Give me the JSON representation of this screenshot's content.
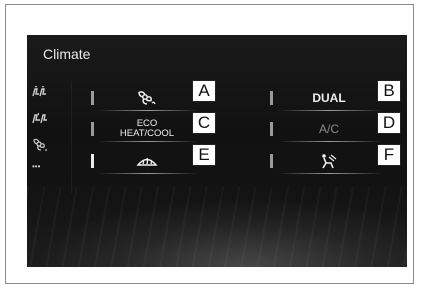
{
  "screen": {
    "title": "Climate"
  },
  "sidebar": {
    "items": [
      {
        "icon": "seat-ventilation-icon"
      },
      {
        "icon": "seat-heater-icon"
      },
      {
        "icon": "fan-icon"
      },
      {
        "icon": "more-icon",
        "label": "•••"
      }
    ]
  },
  "buttons": [
    {
      "id": "A",
      "icon": "fan-auto-icon",
      "label": "",
      "active": false
    },
    {
      "id": "B",
      "label": "DUAL",
      "active": false
    },
    {
      "id": "C",
      "label_line1": "ECO",
      "label_line2": "HEAT/COOL",
      "active": false
    },
    {
      "id": "D",
      "label": "A/C",
      "active": false,
      "dimmed": true
    },
    {
      "id": "E",
      "icon": "front-defroster-icon",
      "active": true
    },
    {
      "id": "F",
      "icon": "air-to-feet-icon",
      "active": false
    }
  ],
  "callouts": {
    "a": "A",
    "b": "B",
    "c": "C",
    "d": "D",
    "e": "E",
    "f": "F"
  },
  "colors": {
    "screen_bg": "#121212",
    "text": "#f0f0f0",
    "dim_text": "#8a8a8a",
    "indicator_on": "#ededed",
    "indicator_off": "#9a9a9a"
  }
}
